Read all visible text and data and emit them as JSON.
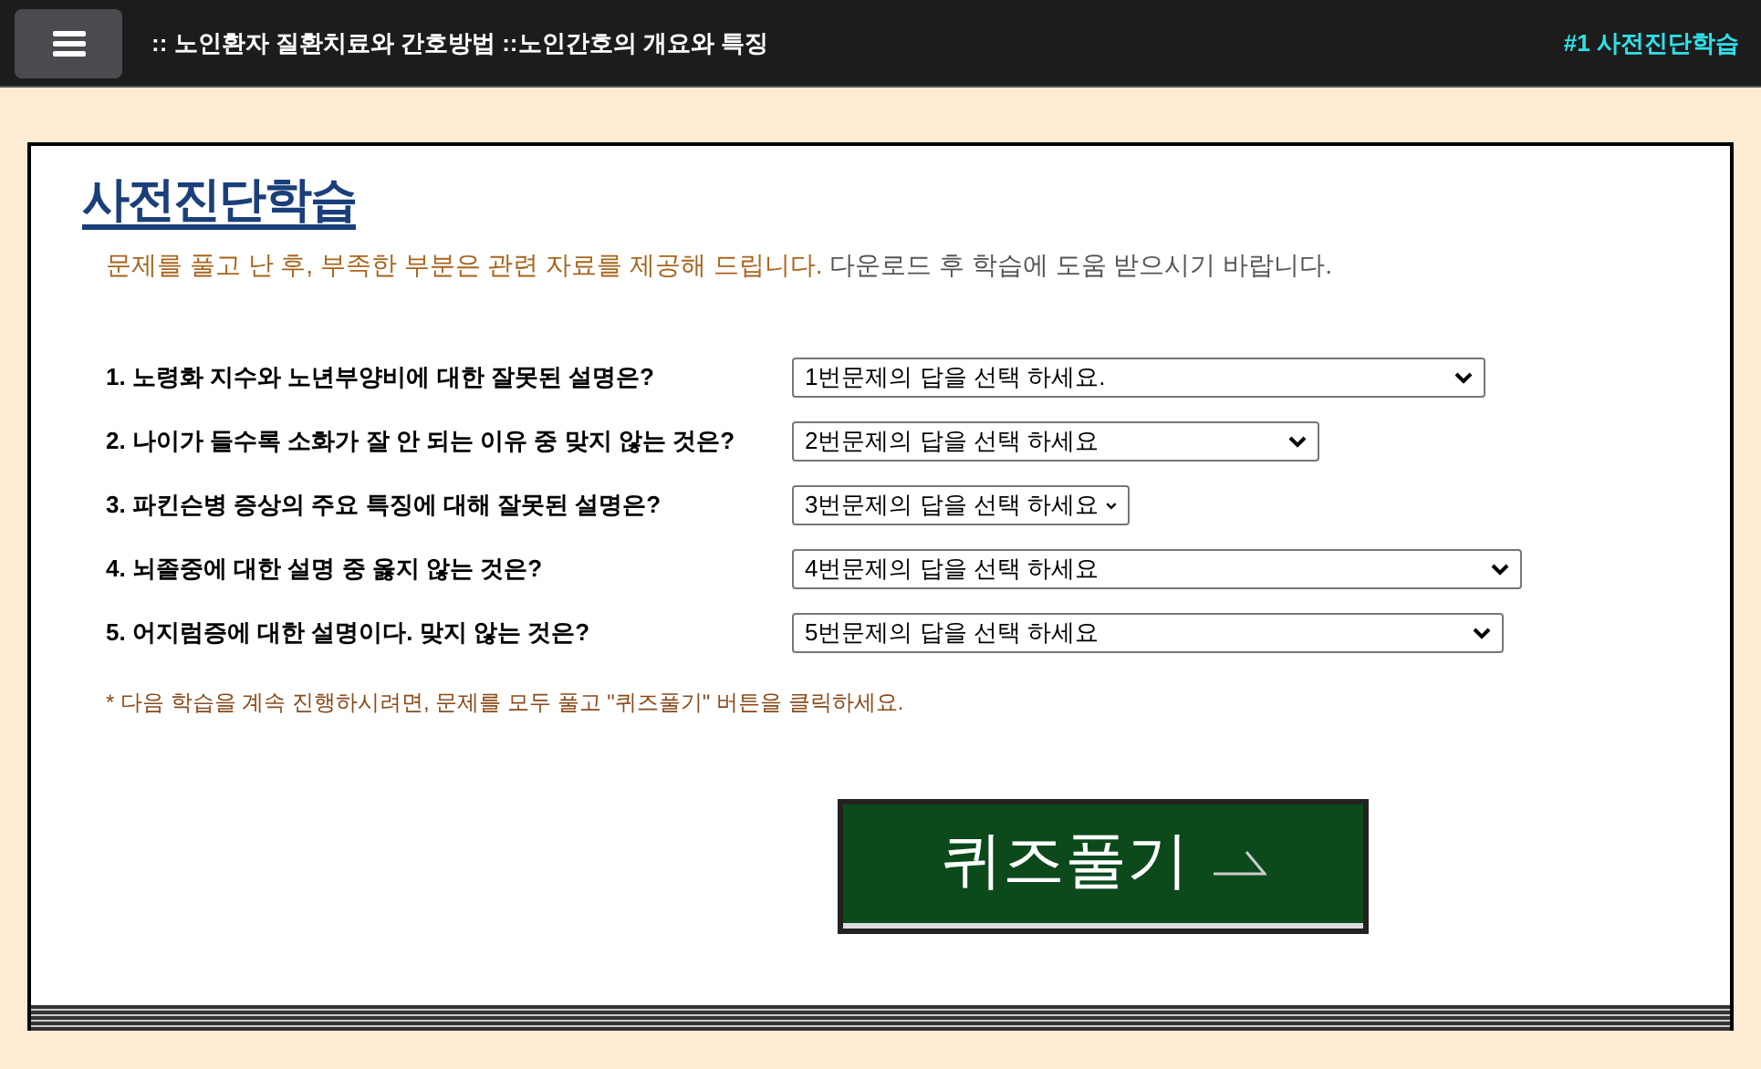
{
  "header": {
    "title": ":: 노인환자 질환치료와 간호방법 ::노인간호의 개요와 특징",
    "badge": "#1 사전진단학습"
  },
  "panel": {
    "heading": "사전진단학습",
    "intro_highlight": "문제를 풀고 난 후, 부족한 부분은 관련 자료를 제공해 드립니다.",
    "intro_rest": "다운로드 후 학습에 도움 받으시기 바랍니다."
  },
  "questions": [
    {
      "label": "1. 노령화 지수와 노년부양비에 대한 잘못된 설명은?",
      "answer": "1번문제의 답을 선택 하세요."
    },
    {
      "label": "2. 나이가 들수록 소화가 잘 안 되는 이유 중 맞지 않는 것은?",
      "answer": "2번문제의 답을 선택 하세요"
    },
    {
      "label": "3. 파킨슨병 증상의 주요 특징에 대해 잘못된 설명은?",
      "answer": "3번문제의 답을 선택 하세요"
    },
    {
      "label": "4. 뇌졸중에 대한 설명 중 옳지 않는 것은?",
      "answer": "4번문제의 답을 선택 하세요"
    },
    {
      "label": "5. 어지럼증에 대한 설명이다. 맞지 않는 것은?",
      "answer": "5번문제의 답을 선택 하세요"
    }
  ],
  "note": "* 다음 학습을 계속 진행하시려면, 문제를 모두 풀고 \"퀴즈풀기\" 버튼을 클릭하세요.",
  "quiz_button": "퀴즈풀기"
}
